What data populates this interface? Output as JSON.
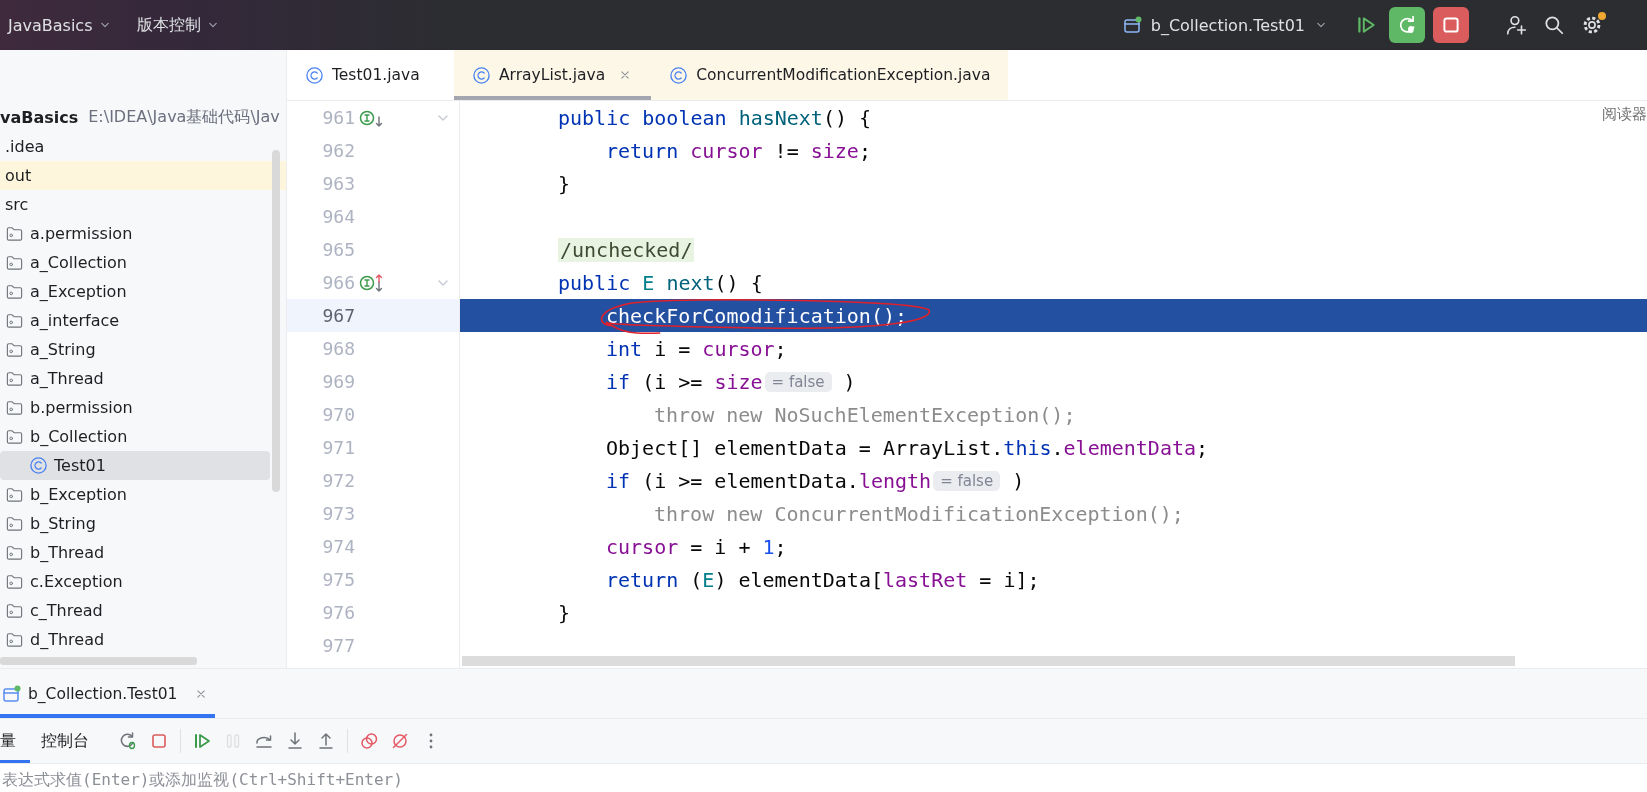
{
  "top_bar": {
    "project": "JavaBasics",
    "vcs": "版本控制",
    "run_config": "b_Collection.Test01",
    "actions": [
      {
        "kind": "resume"
      },
      {
        "kind": "rerun-debug"
      },
      {
        "kind": "stop"
      },
      {
        "kind": "add-user"
      },
      {
        "kind": "search"
      },
      {
        "kind": "settings",
        "notification": true
      }
    ]
  },
  "project_tree": {
    "root": {
      "name": "vaBasics",
      "path": "E:\\IDEA\\Java基础代码\\Jav"
    },
    "items": [
      {
        "name": ".idea",
        "kind": "plain",
        "selected": false,
        "excluded": false
      },
      {
        "name": "out",
        "kind": "plain",
        "selected": false,
        "excluded": true
      },
      {
        "name": "src",
        "kind": "plain",
        "selected": false,
        "excluded": false
      },
      {
        "name": "a.permission",
        "kind": "folder",
        "selected": false,
        "excluded": false
      },
      {
        "name": "a_Collection",
        "kind": "folder",
        "selected": false,
        "excluded": false
      },
      {
        "name": "a_Exception",
        "kind": "folder",
        "selected": false,
        "excluded": false
      },
      {
        "name": "a_interface",
        "kind": "folder",
        "selected": false,
        "excluded": false
      },
      {
        "name": "a_String",
        "kind": "folder",
        "selected": false,
        "excluded": false
      },
      {
        "name": "a_Thread",
        "kind": "folder",
        "selected": false,
        "excluded": false
      },
      {
        "name": "b.permission",
        "kind": "folder",
        "selected": false,
        "excluded": false
      },
      {
        "name": "b_Collection",
        "kind": "folder",
        "selected": false,
        "excluded": false,
        "children": [
          {
            "name": "Test01",
            "kind": "class",
            "selected": true,
            "excluded": false
          }
        ]
      },
      {
        "name": "b_Exception",
        "kind": "folder",
        "selected": false,
        "excluded": false
      },
      {
        "name": "b_String",
        "kind": "folder",
        "selected": false,
        "excluded": false
      },
      {
        "name": "b_Thread",
        "kind": "folder",
        "selected": false,
        "excluded": false
      },
      {
        "name": "c.Exception",
        "kind": "folder",
        "selected": false,
        "excluded": false
      },
      {
        "name": "c_Thread",
        "kind": "folder",
        "selected": false,
        "excluded": false
      },
      {
        "name": "d_Thread",
        "kind": "folder",
        "selected": false,
        "excluded": false
      }
    ]
  },
  "editor_tabs": [
    {
      "label": "Test01.java",
      "selected": false,
      "non_project": false,
      "closable": false
    },
    {
      "label": "ArrayList.java",
      "selected": true,
      "non_project": true,
      "closable": true
    },
    {
      "label": "ConcurrentModificationException.java",
      "selected": false,
      "non_project": true,
      "closable": false
    }
  ],
  "reader_mode": "阅读器",
  "code_lines": [
    {
      "number": "961",
      "marker": {
        "kind": "down"
      },
      "foldable": true,
      "current": false,
      "circled": false,
      "tokens": [
        {
          "kind": "keyword",
          "text": "public boolean "
        },
        {
          "kind": "method",
          "text": "hasNext"
        },
        {
          "kind": "plain",
          "text": "() {"
        }
      ],
      "children": [
        {
          "number": "962",
          "foldable": false,
          "current": false,
          "circled": false,
          "tokens": [
            {
              "kind": "keyword",
              "text": "return "
            },
            {
              "kind": "field",
              "text": "cursor"
            },
            {
              "kind": "plain",
              "text": " != "
            },
            {
              "kind": "field",
              "text": "size"
            },
            {
              "kind": "plain",
              "text": ";"
            }
          ]
        }
      ]
    },
    {
      "number": "963",
      "foldable": false,
      "current": false,
      "circled": false,
      "tokens": [
        {
          "kind": "plain",
          "text": "}"
        }
      ]
    },
    {
      "number": "964",
      "foldable": false,
      "current": false,
      "circled": false
    },
    {
      "number": "965",
      "foldable": false,
      "current": false,
      "circled": false,
      "tokens": [
        {
          "kind": "doc",
          "text": "/unchecked/"
        }
      ]
    },
    {
      "number": "966",
      "marker": {
        "kind": "up-down"
      },
      "foldable": true,
      "current": false,
      "circled": false,
      "tokens": [
        {
          "kind": "keyword",
          "text": "public "
        },
        {
          "kind": "type",
          "text": "E"
        },
        {
          "kind": "method",
          "text": " next"
        },
        {
          "kind": "plain",
          "text": "() {"
        }
      ],
      "children": [
        {
          "number": "967",
          "foldable": false,
          "current": true,
          "circled": true,
          "tokens": [
            {
              "kind": "plain",
              "text": "checkForComodification();"
            }
          ]
        },
        {
          "number": "968",
          "foldable": false,
          "current": false,
          "circled": false,
          "tokens": [
            {
              "kind": "keyword",
              "text": "int "
            },
            {
              "kind": "plain",
              "text": "i = "
            },
            {
              "kind": "field",
              "text": "cursor"
            },
            {
              "kind": "plain",
              "text": ";"
            }
          ]
        },
        {
          "number": "969",
          "foldable": false,
          "current": false,
          "circled": false,
          "tokens": [
            {
              "kind": "keyword",
              "text": "if "
            },
            {
              "kind": "plain",
              "text": "(i >= "
            },
            {
              "kind": "field",
              "text": "size"
            },
            {
              "kind": "hint",
              "text": "= false"
            },
            {
              "kind": "plain",
              "text": " )"
            }
          ],
          "children": [
            {
              "number": "970",
              "foldable": false,
              "current": false,
              "circled": false,
              "tokens": [
                {
                  "kind": "dim",
                  "text": "throw new NoSuchElementException();"
                }
              ]
            }
          ]
        },
        {
          "number": "971",
          "foldable": false,
          "current": false,
          "circled": false,
          "tokens": [
            {
              "kind": "plain",
              "text": "Object[] elementData = ArrayList."
            },
            {
              "kind": "keyword",
              "text": "this"
            },
            {
              "kind": "plain",
              "text": "."
            },
            {
              "kind": "field",
              "text": "elementData"
            },
            {
              "kind": "plain",
              "text": ";"
            }
          ]
        },
        {
          "number": "972",
          "foldable": false,
          "current": false,
          "circled": false,
          "tokens": [
            {
              "kind": "keyword",
              "text": "if "
            },
            {
              "kind": "plain",
              "text": "(i >= elementData."
            },
            {
              "kind": "field",
              "text": "length"
            },
            {
              "kind": "hint",
              "text": "= false"
            },
            {
              "kind": "plain",
              "text": " )"
            }
          ],
          "children": [
            {
              "number": "973",
              "foldable": false,
              "current": false,
              "circled": false,
              "tokens": [
                {
                  "kind": "dim",
                  "text": "throw new ConcurrentModificationException();"
                }
              ]
            }
          ]
        },
        {
          "number": "974",
          "foldable": false,
          "current": false,
          "circled": false,
          "tokens": [
            {
              "kind": "field",
              "text": "cursor"
            },
            {
              "kind": "plain",
              "text": " = i + "
            },
            {
              "kind": "number",
              "text": "1"
            },
            {
              "kind": "plain",
              "text": ";"
            }
          ]
        },
        {
          "number": "975",
          "foldable": false,
          "current": false,
          "circled": false,
          "tokens": [
            {
              "kind": "keyword",
              "text": "return "
            },
            {
              "kind": "plain",
              "text": "("
            },
            {
              "kind": "type",
              "text": "E"
            },
            {
              "kind": "plain",
              "text": ") elementData["
            },
            {
              "kind": "field",
              "text": "lastRet"
            },
            {
              "kind": "plain",
              "text": " = i];"
            }
          ]
        }
      ]
    },
    {
      "number": "976",
      "foldable": false,
      "current": false,
      "circled": false,
      "tokens": [
        {
          "kind": "plain",
          "text": "}"
        }
      ]
    },
    {
      "number": "977",
      "foldable": false,
      "current": false,
      "circled": false
    }
  ],
  "debug_panel": {
    "session_tab": {
      "label": "b_Collection.Test01",
      "selected": true
    },
    "tabs": [
      {
        "label": "量",
        "selected": true
      },
      {
        "label": "控制台",
        "selected": false
      }
    ],
    "toolbar": [
      {
        "kind": "rerun",
        "disabled": false
      },
      {
        "kind": "stop",
        "disabled": false
      },
      {
        "kind": "separator"
      },
      {
        "kind": "resume",
        "disabled": false
      },
      {
        "kind": "pause",
        "disabled": true
      },
      {
        "kind": "step-over",
        "disabled": false
      },
      {
        "kind": "step-into",
        "disabled": false
      },
      {
        "kind": "step-out",
        "disabled": false
      },
      {
        "kind": "separator"
      },
      {
        "kind": "breakpoints",
        "disabled": false
      },
      {
        "kind": "mute-breakpoints",
        "disabled": false
      },
      {
        "kind": "more",
        "disabled": false
      }
    ],
    "eval_placeholder": "表达式求值(Enter)或添加监视(Ctrl+Shift+Enter)"
  }
}
